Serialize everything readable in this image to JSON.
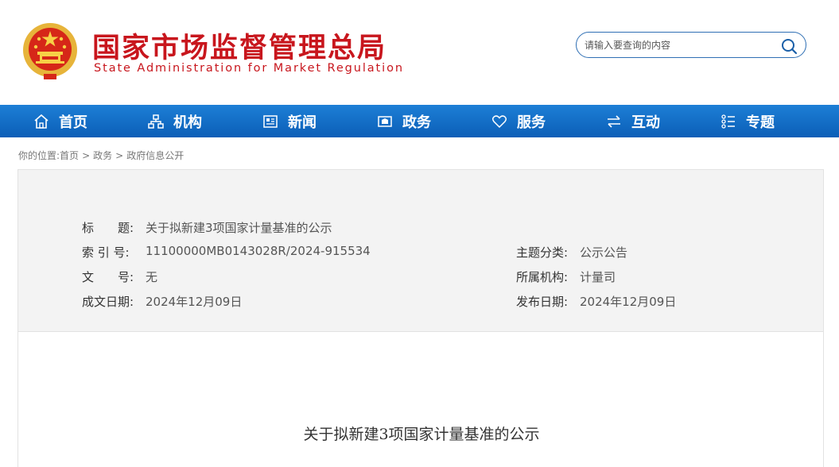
{
  "header": {
    "title": "国家市场监督管理总局",
    "subtitle": "State Administration for Market Regulation",
    "search_placeholder": "请输入要查询的内容"
  },
  "nav": [
    {
      "label": "首页",
      "icon": "home-icon"
    },
    {
      "label": "机构",
      "icon": "org-chart-icon"
    },
    {
      "label": "新闻",
      "icon": "news-icon"
    },
    {
      "label": "政务",
      "icon": "government-affairs-icon"
    },
    {
      "label": "服务",
      "icon": "heart-icon"
    },
    {
      "label": "互动",
      "icon": "exchange-arrows-icon"
    },
    {
      "label": "专题",
      "icon": "topics-list-icon"
    }
  ],
  "breadcrumb": {
    "prefix": "你的位置:",
    "items": [
      "首页",
      "政务",
      "政府信息公开"
    ]
  },
  "meta": {
    "title_label": "标　　题:",
    "title_value": "关于拟新建3项国家计量基准的公示",
    "index_label": "索 引 号:",
    "index_value": "11100000MB0143028R/2024-915534",
    "doc_no_label": "文　　号:",
    "doc_no_value": "无",
    "date_label": "成文日期:",
    "date_value": "2024年12月09日",
    "category_label": "主题分类:",
    "category_value": "公示公告",
    "agency_label": "所属机构:",
    "agency_value": "计量司",
    "publish_label": "发布日期:",
    "publish_value": "2024年12月09日"
  },
  "article": {
    "title": "关于拟新建3项国家计量基准的公示"
  },
  "colors": {
    "brand_red": "#c8161d",
    "nav_blue": "#0b5eb7",
    "meta_bg": "#f3f3f3"
  }
}
